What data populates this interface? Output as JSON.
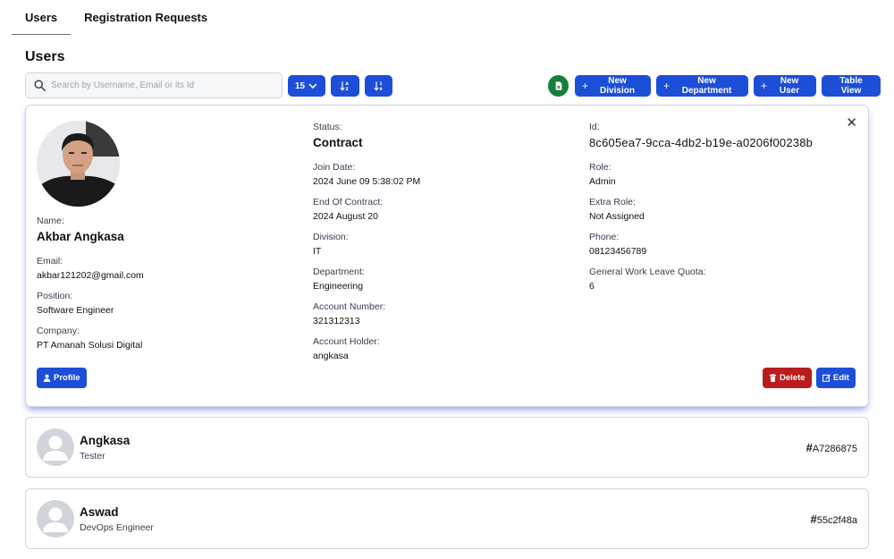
{
  "tabs": [
    {
      "label": "Users",
      "active": true
    },
    {
      "label": "Registration Requests",
      "active": false
    }
  ],
  "page_title": "Users",
  "toolbar": {
    "search_placeholder": "Search by Username, Email or its Id",
    "page_size": "15",
    "buttons": {
      "new_division": "New Division",
      "new_department": "New Department",
      "new_user": "New User",
      "table_view": "Table View"
    }
  },
  "expanded_user": {
    "left": [
      {
        "label": "Name:",
        "value": "Akbar Angkasa",
        "big": true
      },
      {
        "label": "Email:",
        "value": "akbar121202@gmail.com"
      },
      {
        "label": "Position:",
        "value": "Software Engineer"
      },
      {
        "label": "Company:",
        "value": "PT Amanah Solusi Digital"
      }
    ],
    "middle": [
      {
        "label": "Status:",
        "value": "Contract",
        "big": true
      },
      {
        "label": "Join Date:",
        "value": "2024 June 09 5:38:02 PM"
      },
      {
        "label": "End Of Contract:",
        "value": "2024 August 20"
      },
      {
        "label": "Division:",
        "value": "IT"
      },
      {
        "label": "Department:",
        "value": "Engineering"
      },
      {
        "label": "Account Number:",
        "value": "321312313"
      },
      {
        "label": "Account Holder:",
        "value": "angkasa"
      }
    ],
    "right": [
      {
        "label": "Id:",
        "value": "8c605ea7-9cca-4db2-b19e-a0206f00238b",
        "mono": true
      },
      {
        "label": "Role:",
        "value": "Admin"
      },
      {
        "label": "Extra Role:",
        "value": "Not Assigned"
      },
      {
        "label": "Phone:",
        "value": "08123456789"
      },
      {
        "label": "General Work Leave Quota:",
        "value": "6"
      }
    ],
    "buttons": {
      "profile": "Profile",
      "delete": "Delete",
      "edit": "Edit"
    }
  },
  "users": [
    {
      "name": "Angkasa",
      "role": "Tester",
      "id": "A7286875"
    },
    {
      "name": "Aswad",
      "role": "DevOps Engineer",
      "id": "55c2f48a"
    }
  ],
  "colors": {
    "primary": "#1d4ed8",
    "danger": "#b91c1c",
    "success": "#15803d"
  }
}
